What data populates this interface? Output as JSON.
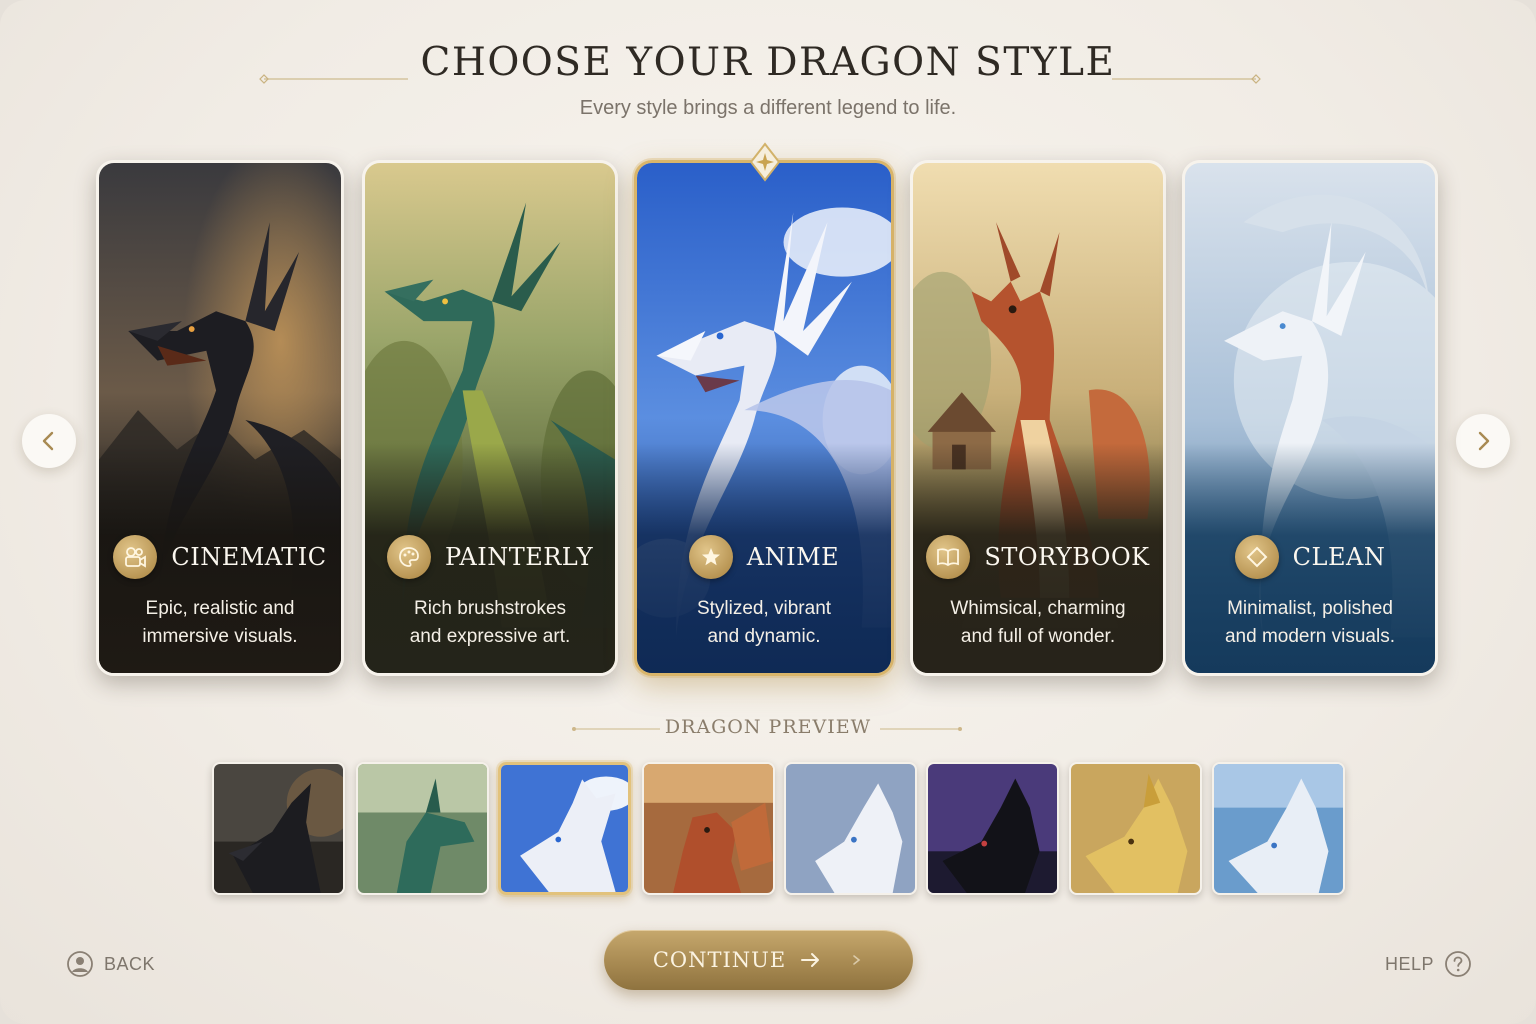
{
  "header": {
    "title": "CHOOSE YOUR DRAGON STYLE",
    "subtitle": "Every style brings a different legend to life."
  },
  "styles": [
    {
      "title": "CINEMATIC",
      "desc_line1": "Epic, realistic and",
      "desc_line2": "immersive visuals.",
      "icon": "camera-icon",
      "selected": false
    },
    {
      "title": "PAINTERLY",
      "desc_line1": "Rich brushstrokes",
      "desc_line2": "and expressive art.",
      "icon": "palette-icon",
      "selected": false
    },
    {
      "title": "ANIME",
      "desc_line1": "Stylized, vibrant",
      "desc_line2": "and dynamic.",
      "icon": "star-icon",
      "selected": true
    },
    {
      "title": "STORYBOOK",
      "desc_line1": "Whimsical, charming",
      "desc_line2": "and full of wonder.",
      "icon": "book-icon",
      "selected": false
    },
    {
      "title": "CLEAN",
      "desc_line1": "Minimalist, polished",
      "desc_line2": "and modern visuals.",
      "icon": "diamond-icon",
      "selected": false
    }
  ],
  "preview": {
    "label": "DRAGON PREVIEW",
    "selected_index": 2,
    "thumbnails": [
      "dark-dragon",
      "green-dragon",
      "white-anime-dragon",
      "red-dragon",
      "pale-dragon",
      "black-purple-dragon",
      "gold-dragon",
      "blue-white-dragon"
    ]
  },
  "footer": {
    "back_label": "BACK",
    "continue_label": "CONTINUE",
    "help_label": "HELP"
  },
  "colors": {
    "accent_gold": "#c6a86d",
    "title_text": "#2f2a24",
    "background": "#f4f0ea"
  }
}
